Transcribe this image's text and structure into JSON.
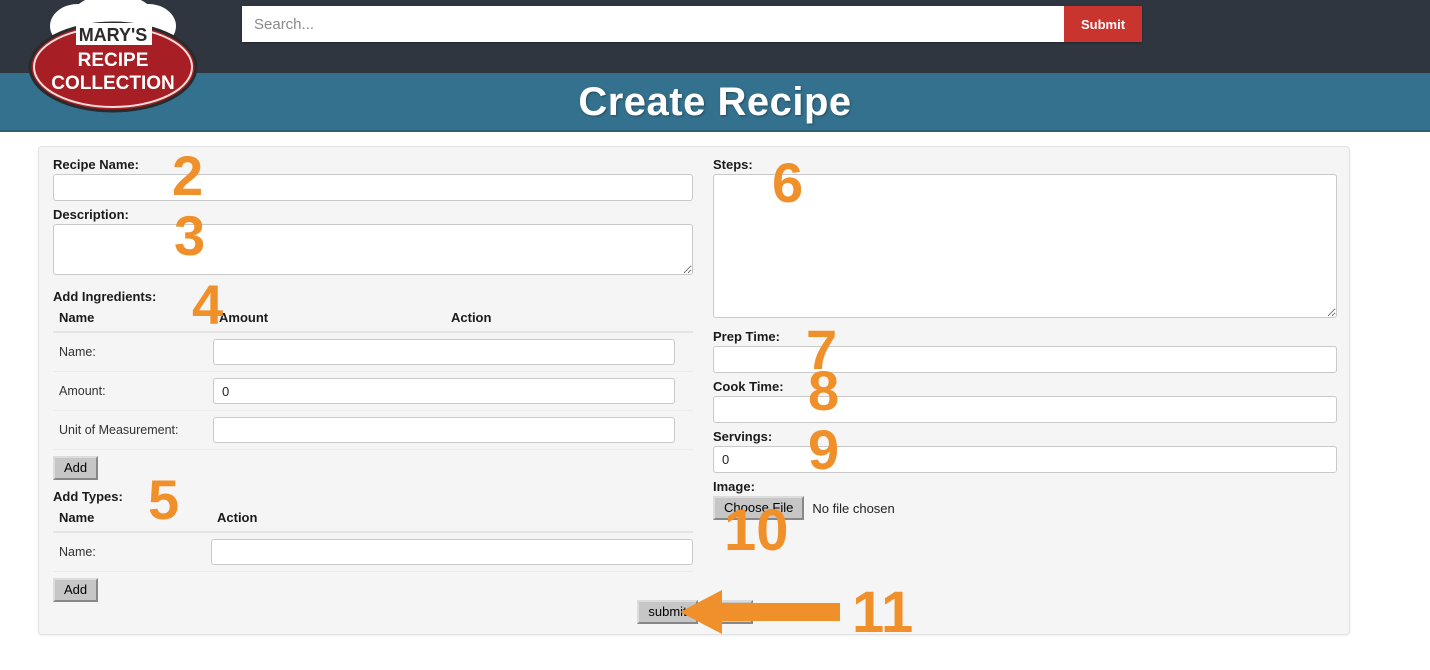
{
  "header": {
    "logo": {
      "line1": "MARY'S",
      "line2": "RECIPE",
      "line3": "COLLECTION",
      "hat_color": "#ffffff",
      "oval_color": "#a71f24"
    },
    "search": {
      "placeholder": "Search...",
      "value": "",
      "submit_label": "Submit",
      "submit_color": "#c9342e"
    },
    "bar_color": "#2f3640"
  },
  "banner": {
    "title": "Create Recipe",
    "background": "#34718e"
  },
  "form": {
    "recipe_name": {
      "label": "Recipe Name:",
      "value": ""
    },
    "description": {
      "label": "Description:",
      "value": ""
    },
    "ingredients": {
      "label": "Add Ingredients:",
      "columns": [
        "Name",
        "Amount",
        "Action"
      ],
      "rows": [
        {
          "label": "Name:",
          "value": ""
        },
        {
          "label": "Amount:",
          "value": "0"
        },
        {
          "label": "Unit of Measurement:",
          "value": ""
        }
      ],
      "add_label": "Add"
    },
    "types": {
      "label": "Add Types:",
      "columns": [
        "Name",
        "Action"
      ],
      "rows": [
        {
          "label": "Name:",
          "value": ""
        }
      ],
      "add_label": "Add"
    },
    "steps": {
      "label": "Steps:",
      "value": ""
    },
    "prep_time": {
      "label": "Prep Time:",
      "value": ""
    },
    "cook_time": {
      "label": "Cook Time:",
      "value": ""
    },
    "servings": {
      "label": "Servings:",
      "value": "0"
    },
    "image": {
      "label": "Image:",
      "choose_label": "Choose File",
      "status": "No file chosen"
    },
    "submit_label": "submit",
    "back_label": "Back"
  },
  "annotations": {
    "color": "#f0902a",
    "markers": [
      {
        "id": "2",
        "target": "recipe-name"
      },
      {
        "id": "3",
        "target": "description"
      },
      {
        "id": "4",
        "target": "add-ingredients"
      },
      {
        "id": "5",
        "target": "add-types"
      },
      {
        "id": "6",
        "target": "steps"
      },
      {
        "id": "7",
        "target": "prep-time"
      },
      {
        "id": "8",
        "target": "cook-time"
      },
      {
        "id": "9",
        "target": "servings"
      },
      {
        "id": "10",
        "target": "image"
      },
      {
        "id": "11",
        "target": "submit-back-buttons"
      }
    ]
  }
}
